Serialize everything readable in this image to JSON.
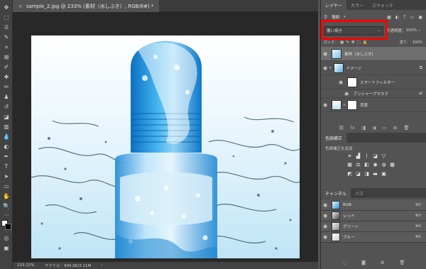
{
  "document": {
    "tab_title": "sample_2.jpg @ 233% (素材（水しぶき）, RGB/8#) *",
    "close_glyph": "×"
  },
  "status": {
    "zoom": "233.22%",
    "file_info": "ファイル：900.0K/3.11M"
  },
  "layers_panel": {
    "tabs": [
      "レイヤー",
      "カラー",
      "スウォッチ"
    ],
    "filter_kind": "種類",
    "blend_mode": "覆い焼き",
    "opacity_label": "不透明度：",
    "opacity_value": "100%",
    "lock_label": "ロック：",
    "fill_label": "塗り：",
    "fill_value": "100%",
    "layers": [
      {
        "name": "素材（水しぶき）",
        "selected": true
      },
      {
        "name": "イメージ",
        "selected": false
      },
      {
        "name": "スマートフィルター",
        "selected": false
      },
      {
        "name": "アンシャープマスク",
        "selected": false
      },
      {
        "name": "背景",
        "selected": false
      }
    ],
    "footer_icons": [
      "link-icon",
      "fx-icon",
      "mask-icon",
      "adjustment-icon",
      "folder-icon",
      "new-layer-icon",
      "trash-icon"
    ]
  },
  "adjustments_panel": {
    "title": "色調補正",
    "subtitle": "色調補正を追加"
  },
  "channels_panel": {
    "tabs": [
      "チャンネル",
      "パス"
    ],
    "channels": [
      {
        "name": "RGB",
        "shortcut": "⌘2"
      },
      {
        "name": "レッド",
        "shortcut": "⌘3"
      },
      {
        "name": "グリーン",
        "shortcut": "⌘4"
      },
      {
        "name": "ブルー",
        "shortcut": "⌘5"
      }
    ]
  },
  "colors": {
    "highlight": "#ff0000",
    "accent_blue": "#1e8fd6"
  }
}
